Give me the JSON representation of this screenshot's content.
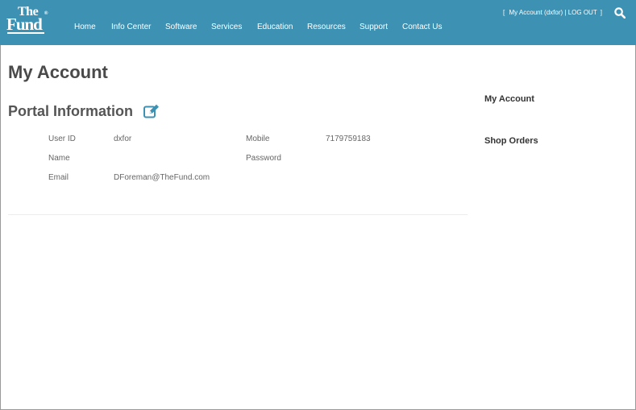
{
  "header": {
    "logo": {
      "line1": "The",
      "line2": "Fund",
      "mark": "®"
    },
    "nav": [
      "Home",
      "Info Center",
      "Software",
      "Services",
      "Education",
      "Resources",
      "Support",
      "Contact Us"
    ],
    "account_bracket_open": "[",
    "account_link": "My Account (dxfor)",
    "account_separator": "|",
    "logout_link": "LOG OUT",
    "account_bracket_close": "]",
    "search_icon": "search-icon"
  },
  "main": {
    "title": "My Account",
    "section_title": "Portal Information",
    "edit_icon": "edit-icon",
    "fields": {
      "user_id": {
        "label": "User ID",
        "value": "dxfor"
      },
      "mobile": {
        "label": "Mobile",
        "value": "7179759183"
      },
      "name": {
        "label": "Name",
        "value": ""
      },
      "password": {
        "label": "Password",
        "value": ""
      },
      "email": {
        "label": "Email",
        "value": "DForeman@TheFund.com"
      }
    }
  },
  "sidebar": {
    "items": [
      "My Account",
      "Shop Orders"
    ]
  },
  "colors": {
    "header_bg": "#3d92b4",
    "accent": "#3d92b4",
    "title_text": "#4a4a4a"
  }
}
